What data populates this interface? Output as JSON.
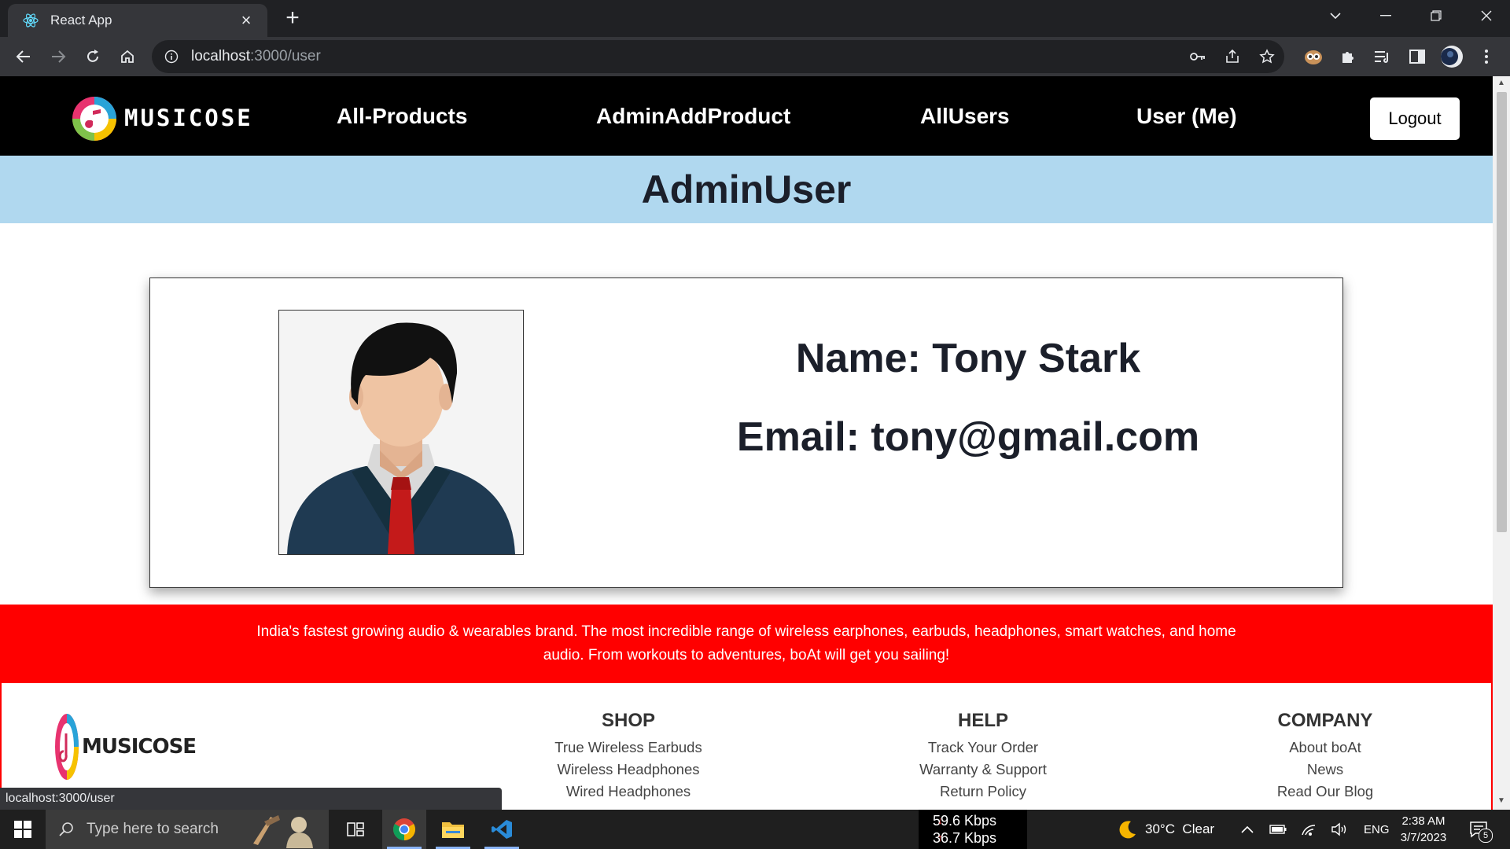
{
  "browser": {
    "tab_title": "React App",
    "url_host": "localhost",
    "url_rest": ":3000/user",
    "status_url": "localhost:3000/user"
  },
  "navbar": {
    "logo_text": "MUSICOSE",
    "links": [
      "All-Products",
      "AdminAddProduct",
      "AllUsers",
      "User (Me)"
    ],
    "logout_label": "Logout"
  },
  "page": {
    "title": "AdminUser",
    "name_text": "Name: Tony Stark",
    "email_text": "Email: tony@gmail.com"
  },
  "promo": {
    "text": "India's fastest growing audio & wearables brand. The most incredible range of wireless earphones, earbuds, headphones, smart watches, and home audio. From workouts to adventures, boAt will get you sailing!"
  },
  "footer": {
    "logo_text": "MUSICOSE",
    "columns": [
      {
        "heading": "SHOP",
        "items": [
          "True Wireless Earbuds",
          "Wireless Headphones",
          "Wired Headphones"
        ]
      },
      {
        "heading": "HELP",
        "items": [
          "Track Your Order",
          "Warranty & Support",
          "Return Policy"
        ]
      },
      {
        "heading": "COMPANY",
        "items": [
          "About boAt",
          "News",
          "Read Our Blog"
        ]
      }
    ]
  },
  "taskbar": {
    "search_placeholder": "Type here to search",
    "net_down": "59.6 Kbps",
    "net_up": "36.7 Kbps",
    "weather": "30°C  Clear",
    "language": "ENG",
    "time": "2:38 AM",
    "date": "3/7/2023",
    "notification_count": "5"
  },
  "colors": {
    "navbar_bg": "#000000",
    "title_band_bg": "#b0d8ef",
    "promo_bg": "#ff0000",
    "chrome_dark": "#202124",
    "chrome_toolbar": "#35363a"
  }
}
